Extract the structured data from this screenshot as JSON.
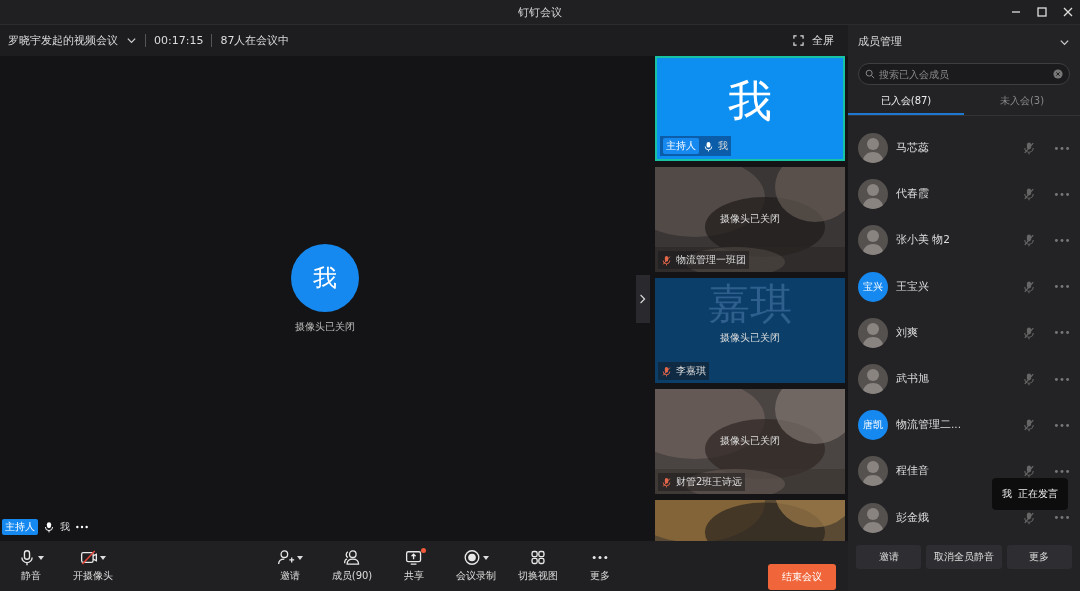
{
  "window": {
    "title": "钉钉会议"
  },
  "meeting_bar": {
    "title": "罗晓宇发起的视频会议",
    "duration": "00:17:15",
    "attendance": "87人在会议中",
    "fullscreen": "全屏"
  },
  "main_video": {
    "avatar": "我",
    "status": "摄像头已关闭",
    "badge": "主持人",
    "name": "我",
    "mic_muted": false
  },
  "tiles": [
    {
      "kind": "avatar",
      "avatar": "我",
      "badge": "主持人",
      "name": "我",
      "mic_muted": false,
      "speaking": true
    },
    {
      "kind": "camera_off",
      "status": "摄像头已关闭",
      "name": "物流管理一班团",
      "mic_muted": true,
      "speaking": false
    },
    {
      "kind": "name_card",
      "card": "嘉琪",
      "status": "摄像头已关闭",
      "name": "李嘉琪",
      "mic_muted": true,
      "speaking": false
    },
    {
      "kind": "camera_off",
      "status": "摄像头已关闭",
      "name": "财管2班王诗远",
      "mic_muted": true,
      "speaking": false
    },
    {
      "kind": "picture",
      "speaking": false
    }
  ],
  "toolbar": [
    {
      "label": "静音",
      "kind": "mic",
      "caret": true,
      "dot": false
    },
    {
      "label": "开摄像头",
      "kind": "camera",
      "caret": true,
      "dot": false
    },
    {
      "label": "邀请",
      "kind": "invite",
      "caret": true,
      "dot": false
    },
    {
      "label": "成员(90)",
      "kind": "members",
      "caret": false,
      "dot": false
    },
    {
      "label": "共享",
      "kind": "share",
      "caret": false,
      "dot": true
    },
    {
      "label": "会议录制",
      "kind": "record",
      "caret": true,
      "dot": false
    },
    {
      "label": "切换视图",
      "kind": "layout",
      "caret": false,
      "dot": false
    },
    {
      "label": "更多",
      "kind": "more",
      "caret": false,
      "dot": false
    }
  ],
  "end_button": "结束会议",
  "member_panel": {
    "title": "成员管理",
    "search": {
      "placeholder": "搜索已入会成员"
    },
    "tabs": [
      {
        "label": "已入会(87)",
        "selected": true
      },
      {
        "label": "未入会(3)",
        "selected": false
      }
    ],
    "members": [
      {
        "name": "马芯蕊",
        "mic_muted": true
      },
      {
        "name": "代春霞",
        "mic_muted": true
      },
      {
        "name": "张小美  物2",
        "mic_muted": true
      },
      {
        "name": "王宝兴",
        "kind": "initials",
        "avatar_text": "宝兴",
        "mic_muted": true
      },
      {
        "name": "刘爽",
        "mic_muted": true
      },
      {
        "name": "武书旭",
        "mic_muted": true
      },
      {
        "name": "物流管理二...",
        "kind": "initials",
        "avatar_text": "唐凯",
        "mic_muted": true
      },
      {
        "name": "程佳音",
        "mic_muted": true
      },
      {
        "name": "彭金娥",
        "mic_muted": true
      }
    ],
    "buttons": [
      "邀请",
      "取消全员静音",
      "更多"
    ]
  },
  "toast": "我  正在发言"
}
